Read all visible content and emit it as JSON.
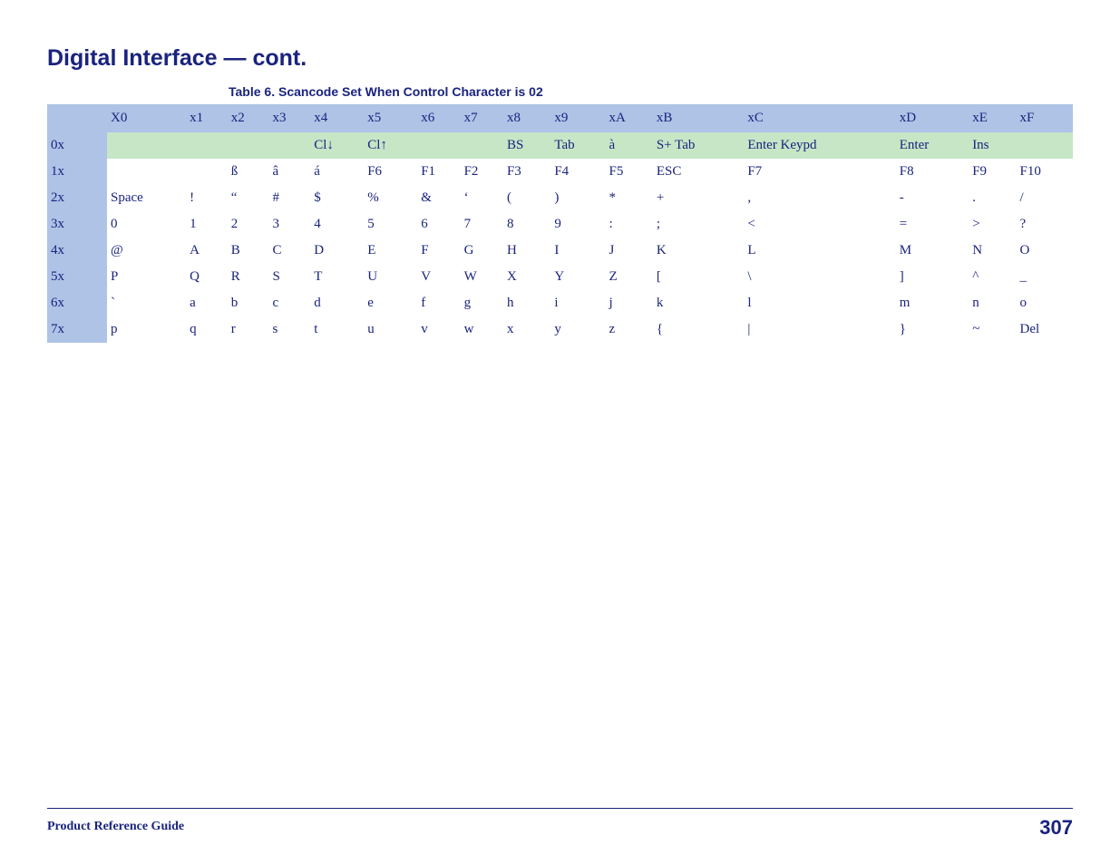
{
  "section_title": "Digital Interface — cont.",
  "table_caption": "Table 6. Scancode Set When Control Character is 02",
  "col_headers": [
    "X0",
    "x1",
    "x2",
    "x3",
    "x4",
    "x5",
    "x6",
    "x7",
    "x8",
    "x9",
    "xA",
    "xB",
    "xC",
    "xD",
    "xE",
    "xF"
  ],
  "rows": [
    {
      "label": "0x",
      "highlight": true,
      "cells": [
        "",
        "",
        "",
        "",
        "Cl↓",
        "Cl↑",
        "",
        "",
        "BS",
        "Tab",
        "à",
        "S+ Tab",
        "Enter Keypd",
        "Enter",
        "Ins",
        ""
      ]
    },
    {
      "label": "1x",
      "highlight": false,
      "cells": [
        "",
        "",
        "ß",
        "â",
        "á",
        "F6",
        "F1",
        "F2",
        "F3",
        "F4",
        "F5",
        "ESC",
        "F7",
        "F8",
        "F9",
        "F10"
      ]
    },
    {
      "label": "2x",
      "highlight": false,
      "cells": [
        "Space",
        "!",
        "“",
        "#",
        "$",
        "%",
        "&",
        "‘",
        "(",
        ")",
        "*",
        "+",
        ",",
        "-",
        ".",
        "/"
      ]
    },
    {
      "label": "3x",
      "highlight": false,
      "cells": [
        "0",
        "1",
        "2",
        "3",
        "4",
        "5",
        "6",
        "7",
        "8",
        "9",
        ":",
        ";",
        "<",
        "=",
        ">",
        "?"
      ]
    },
    {
      "label": "4x",
      "highlight": false,
      "cells": [
        "@",
        "A",
        "B",
        "C",
        "D",
        "E",
        "F",
        "G",
        "H",
        "I",
        "J",
        "K",
        "L",
        "M",
        "N",
        "O"
      ]
    },
    {
      "label": "5x",
      "highlight": false,
      "cells": [
        "P",
        "Q",
        "R",
        "S",
        "T",
        "U",
        "V",
        "W",
        "X",
        "Y",
        "Z",
        "[",
        "\\",
        "]",
        "^",
        "_"
      ]
    },
    {
      "label": "6x",
      "highlight": false,
      "cells": [
        "`",
        "a",
        "b",
        "c",
        "d",
        "e",
        "f",
        "g",
        "h",
        "i",
        "j",
        "k",
        "l",
        "m",
        "n",
        "o"
      ]
    },
    {
      "label": "7x",
      "highlight": false,
      "cells": [
        "p",
        "q",
        "r",
        "s",
        "t",
        "u",
        "v",
        "w",
        "x",
        "y",
        "z",
        "{",
        "|",
        "}",
        "~",
        "Del"
      ]
    }
  ],
  "footer_left": "Product Reference Guide",
  "footer_right": "307"
}
